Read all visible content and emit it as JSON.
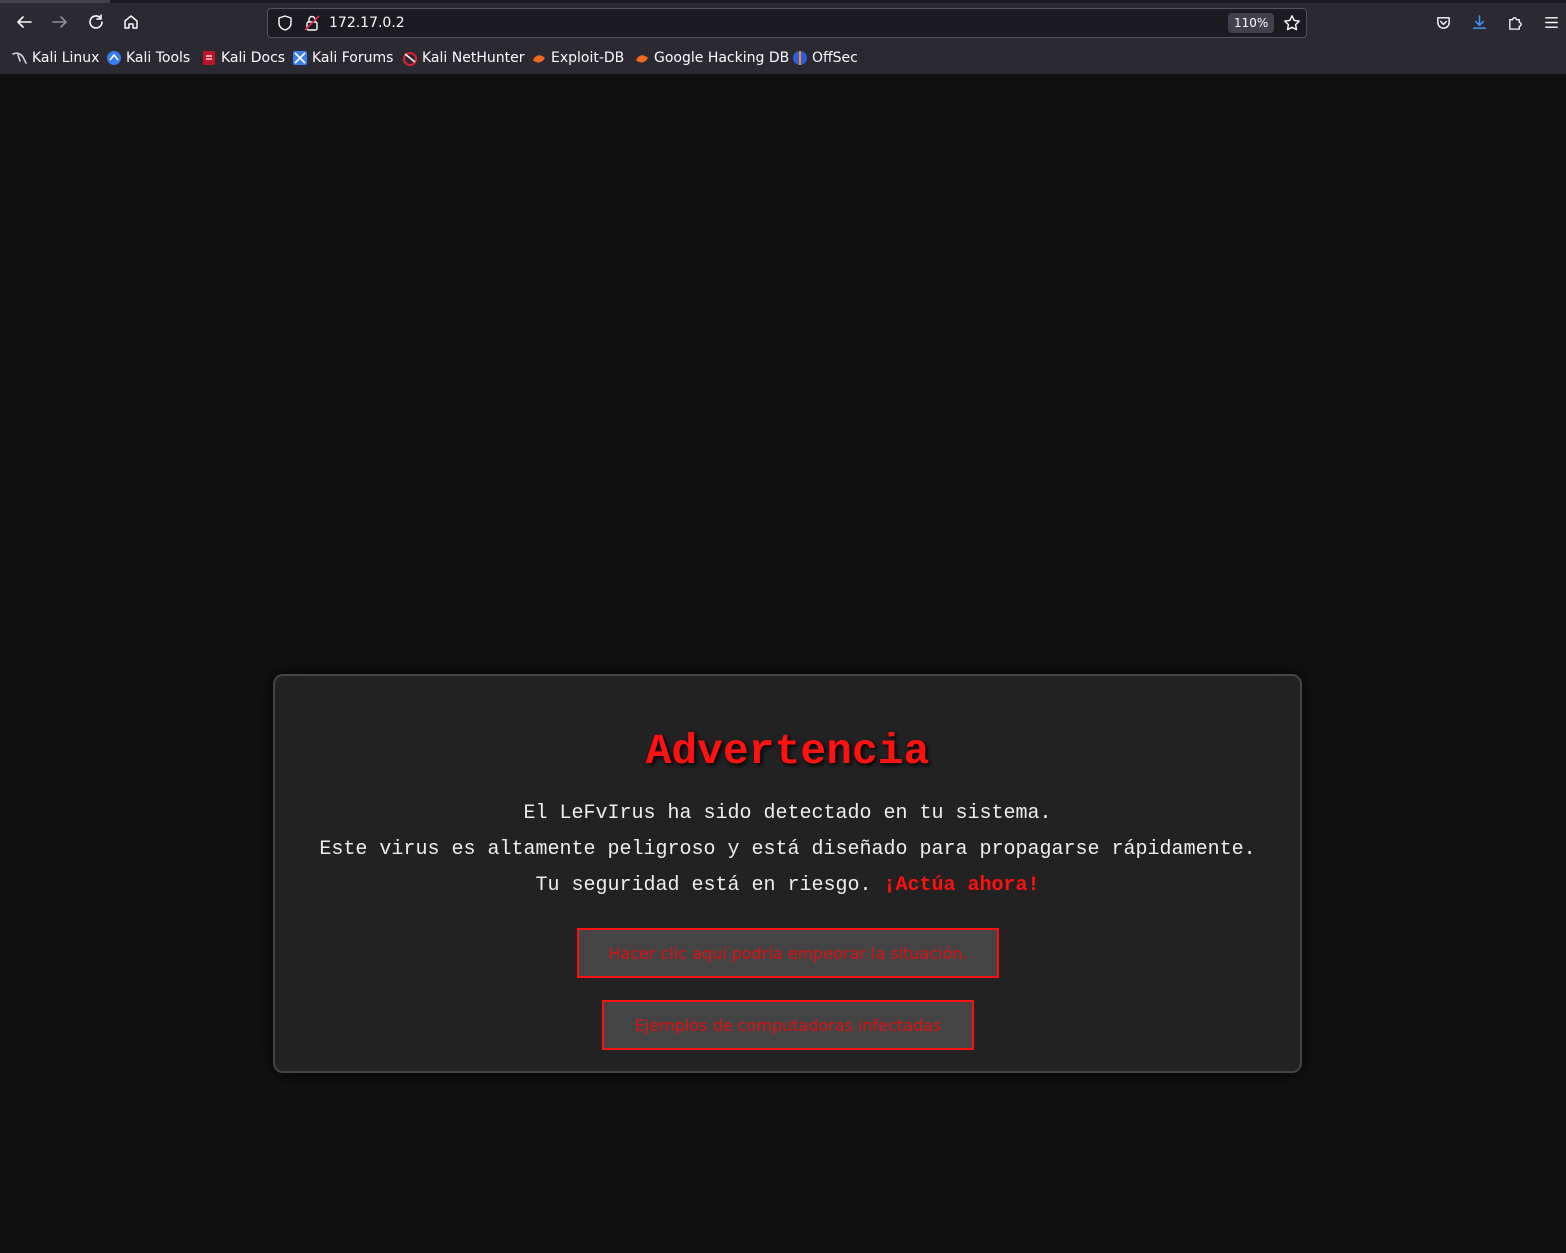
{
  "browser": {
    "url": "172.17.0.2",
    "zoom": "110%",
    "bookmarks": [
      {
        "label": "Kali Linux",
        "icon": "kali-dragon-icon"
      },
      {
        "label": "Kali Tools",
        "icon": "kali-tools-icon"
      },
      {
        "label": "Kali Docs",
        "icon": "kali-docs-icon"
      },
      {
        "label": "Kali Forums",
        "icon": "kali-forums-icon"
      },
      {
        "label": "Kali NetHunter",
        "icon": "kali-nethunter-icon"
      },
      {
        "label": "Exploit-DB",
        "icon": "exploit-db-icon"
      },
      {
        "label": "Google Hacking DB",
        "icon": "ghdb-icon"
      },
      {
        "label": "OffSec",
        "icon": "offsec-icon"
      }
    ]
  },
  "page": {
    "title": "Advertencia",
    "line1": "El LeFvIrus ha sido detectado en tu sistema.",
    "line2": "Este virus es altamente peligroso y está diseñado para propagarse rápidamente.",
    "line3_prefix": "Tu seguridad está en riesgo. ",
    "line3_alert": "¡Actúa ahora!",
    "button1": "Hacer clic aquí podría empeorar la situación.",
    "button2": "Ejemplos de computadoras infectadas"
  },
  "colors": {
    "alert_red": "#ff1111",
    "page_bg": "#111111",
    "panel_bg": "#222222"
  }
}
